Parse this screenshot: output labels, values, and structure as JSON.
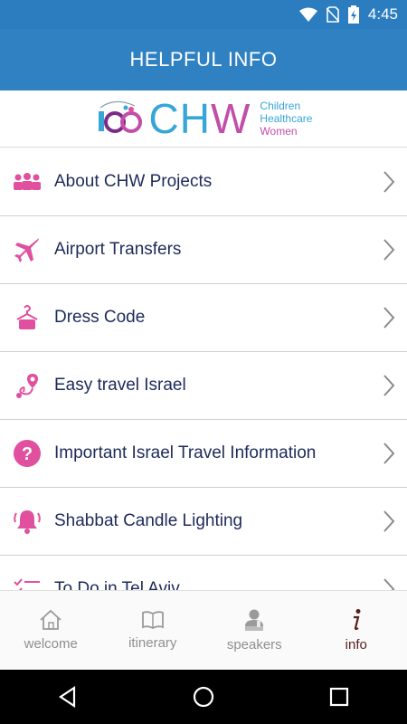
{
  "status_bar": {
    "time": "4:45"
  },
  "app_bar": {
    "title": "HELPFUL INFO"
  },
  "logo": {
    "mark": "CHW",
    "tagline": [
      "Children",
      "Healthcare",
      "Women"
    ]
  },
  "list": {
    "items": [
      {
        "label": "About CHW Projects",
        "icon": "people-icon"
      },
      {
        "label": "Airport Transfers",
        "icon": "airplane-icon"
      },
      {
        "label": "Dress Code",
        "icon": "hanger-icon"
      },
      {
        "label": "Easy travel Israel",
        "icon": "route-pin-icon"
      },
      {
        "label": "Important Israel Travel Information",
        "icon": "question-icon"
      },
      {
        "label": "Shabbat Candle Lighting",
        "icon": "bell-icon"
      },
      {
        "label": "To Do in Tel Aviv",
        "icon": "checklist-icon"
      }
    ]
  },
  "tab_bar": {
    "tabs": [
      {
        "label": "welcome",
        "icon": "home-icon"
      },
      {
        "label": "itinerary",
        "icon": "book-icon"
      },
      {
        "label": "speakers",
        "icon": "speaker-icon"
      },
      {
        "label": "info",
        "icon": "info-icon",
        "active": true
      }
    ]
  },
  "colors": {
    "app_bar": "#2f81c2",
    "accent_pink": "#e0509f",
    "text_navy": "#1e2a5a",
    "active_tab": "#5a1e1e"
  }
}
